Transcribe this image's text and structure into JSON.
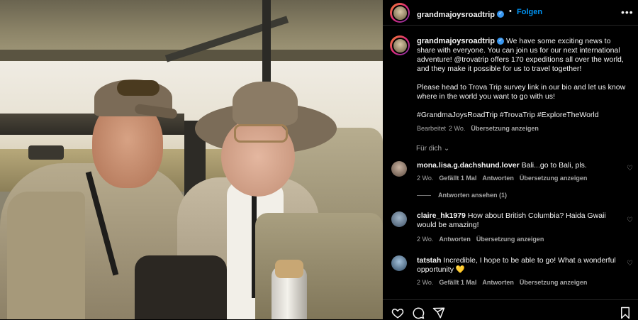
{
  "post": {
    "username": "grandmajoysroadtrip",
    "follow_label": "Folgen",
    "caption": [
      "We have some exciting news to share with everyone. You can join us for our next international adventure! @trovatrip offers 170 expeditions all over the world, and they make it possible for us to travel together!",
      "Please head to Trova Trip survey link in our bio and let us know where in the world you want to go with us!",
      "#GrandmaJoysRoadTrip #TrovaTrip #ExploreTheWorld"
    ],
    "meta": {
      "edited": "Bearbeitet",
      "age": "2 Wo.",
      "translate": "Übersetzung anzeigen"
    },
    "for_you": "Für dich"
  },
  "comments": [
    {
      "user": "mona.lisa.g.dachshund.lover",
      "text": "Bali...go to Bali, pls.",
      "age": "2 Wo.",
      "likes": "Gefällt 1 Mal",
      "reply": "Antworten",
      "translate": "Übersetzung anzeigen",
      "view_replies": "Antworten ansehen (1)"
    },
    {
      "user": "claire_hk1979",
      "text": "How about British Columbia? Haida Gwaii would be amazing!",
      "age": "2 Wo.",
      "reply": "Antworten",
      "translate": "Übersetzung anzeigen"
    },
    {
      "user": "tatstah",
      "text": "Incredible, I hope to be able to go! What a wonderful opportunity 💛",
      "age": "2 Wo.",
      "likes": "Gefällt 1 Mal",
      "reply": "Antworten",
      "translate": "Übersetzung anzeigen"
    }
  ],
  "icons": {
    "verified": "verified-badge-icon",
    "more": "more-options-icon",
    "like": "heart-icon",
    "comment": "comment-icon",
    "share": "share-icon",
    "save": "bookmark-icon"
  },
  "colors": {
    "background": "#000000",
    "link": "#0095f6",
    "muted": "#a8a8a8",
    "verified": "#3897f0"
  }
}
